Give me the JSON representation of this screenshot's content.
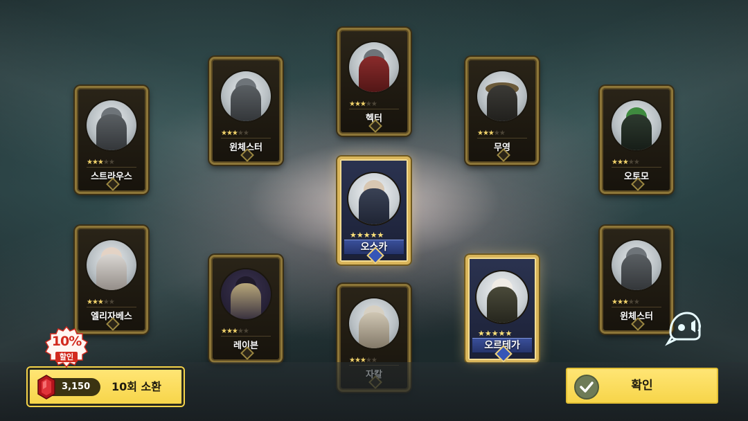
{
  "heroes": [
    {
      "id": "struas",
      "name": "스트라우스",
      "stars": 3
    },
    {
      "id": "winchester-1",
      "name": "윈체스터",
      "stars": 3
    },
    {
      "id": "hector",
      "name": "헥터",
      "stars": 3
    },
    {
      "id": "muyeong",
      "name": "무영",
      "stars": 3
    },
    {
      "id": "otomo",
      "name": "오토모",
      "stars": 3
    },
    {
      "id": "oska",
      "name": "오스카",
      "stars": 5
    },
    {
      "id": "elizabeth",
      "name": "엘리자베스",
      "stars": 3
    },
    {
      "id": "raven",
      "name": "레이븐",
      "stars": 3
    },
    {
      "id": "jakal",
      "name": "자칼",
      "stars": 3
    },
    {
      "id": "ortega",
      "name": "오르테가",
      "stars": 5
    },
    {
      "id": "winchester-2",
      "name": "윈체스터",
      "stars": 3
    }
  ],
  "summon": {
    "price": "3,150",
    "label": "10회 소환",
    "discount_percent": "10%",
    "discount_label": "할인",
    "currency_icon": "ruby-icon"
  },
  "confirm": {
    "label": "확인",
    "icon": "check-icon"
  },
  "voice_button": {
    "icon": "voice-helmet-icon"
  },
  "colors": {
    "button_yellow": "#f7d54a",
    "gold_frame": "#d9b55a",
    "bronze_frame": "#8d7638",
    "discount_red": "#d22a1e",
    "star_gold": "#f2d36b"
  }
}
